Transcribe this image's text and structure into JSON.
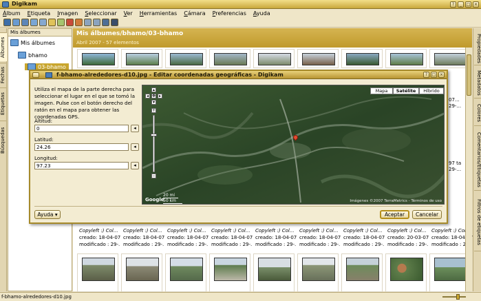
{
  "window": {
    "title": "Digikam"
  },
  "menu": [
    "Álbum",
    "Etiqueta",
    "Imagen",
    "Seleccionar",
    "Ver",
    "Herramientas",
    "Cámara",
    "Preferencias",
    "Ayuda"
  ],
  "left_tabs": [
    "Álbumes",
    "Fechas",
    "Etiquetas",
    "Búsquedas"
  ],
  "right_tabs": [
    "Propiedades",
    "Metadatos",
    "Colores",
    "Comentarios/Etiquetas",
    "Filtros de etiquetas"
  ],
  "tree": {
    "header": "Mis álbumes",
    "items": [
      "Mis álbumes",
      "bhamo",
      "03-bhamo"
    ]
  },
  "album": {
    "path": "Mis álbumes/bhamo/03-bhamo",
    "subtitle": "Abril 2007 - 57 elementos"
  },
  "thumb_meta": {
    "copyright": "Copyleft :) Col...",
    "created": "creado: 18-04-07...",
    "created_alt": "creado: 20-03-07...",
    "modified": "modificado : 29-..."
  },
  "side_meta": {
    "line1": "07...",
    "line2": "29-...",
    "line3": "97 ta"
  },
  "status": {
    "filename": "f-bhamo-alrededores-d10.jpg"
  },
  "dialog": {
    "title": "f-bhamo-alrededores-d10.jpg - Editar coordenadas geográficas - Digikam",
    "instructions": "Utiliza el mapa de la parte derecha para seleccionar el lugar en el que se tomó la imagen. Pulse con el botón derecho del ratón en el mapa para obtener las coordenadas GPS.",
    "altitude_label": "Altitud:",
    "altitude_value": "0",
    "latitude_label": "Latitud:",
    "latitude_value": "24.26",
    "longitude_label": "Longitud:",
    "longitude_value": "97.23",
    "map_types": [
      "Mapa",
      "Satélite",
      "Híbrido"
    ],
    "map_selected": "Satélite",
    "scale_1": "20 mi",
    "scale_2": "50 km",
    "copyright": "Imágenes ©2007 TerraMetrics - Términos de uso",
    "help_button": "Ayuda",
    "ok_button": "Aceptar",
    "cancel_button": "Cancelar",
    "logo": "Google"
  }
}
